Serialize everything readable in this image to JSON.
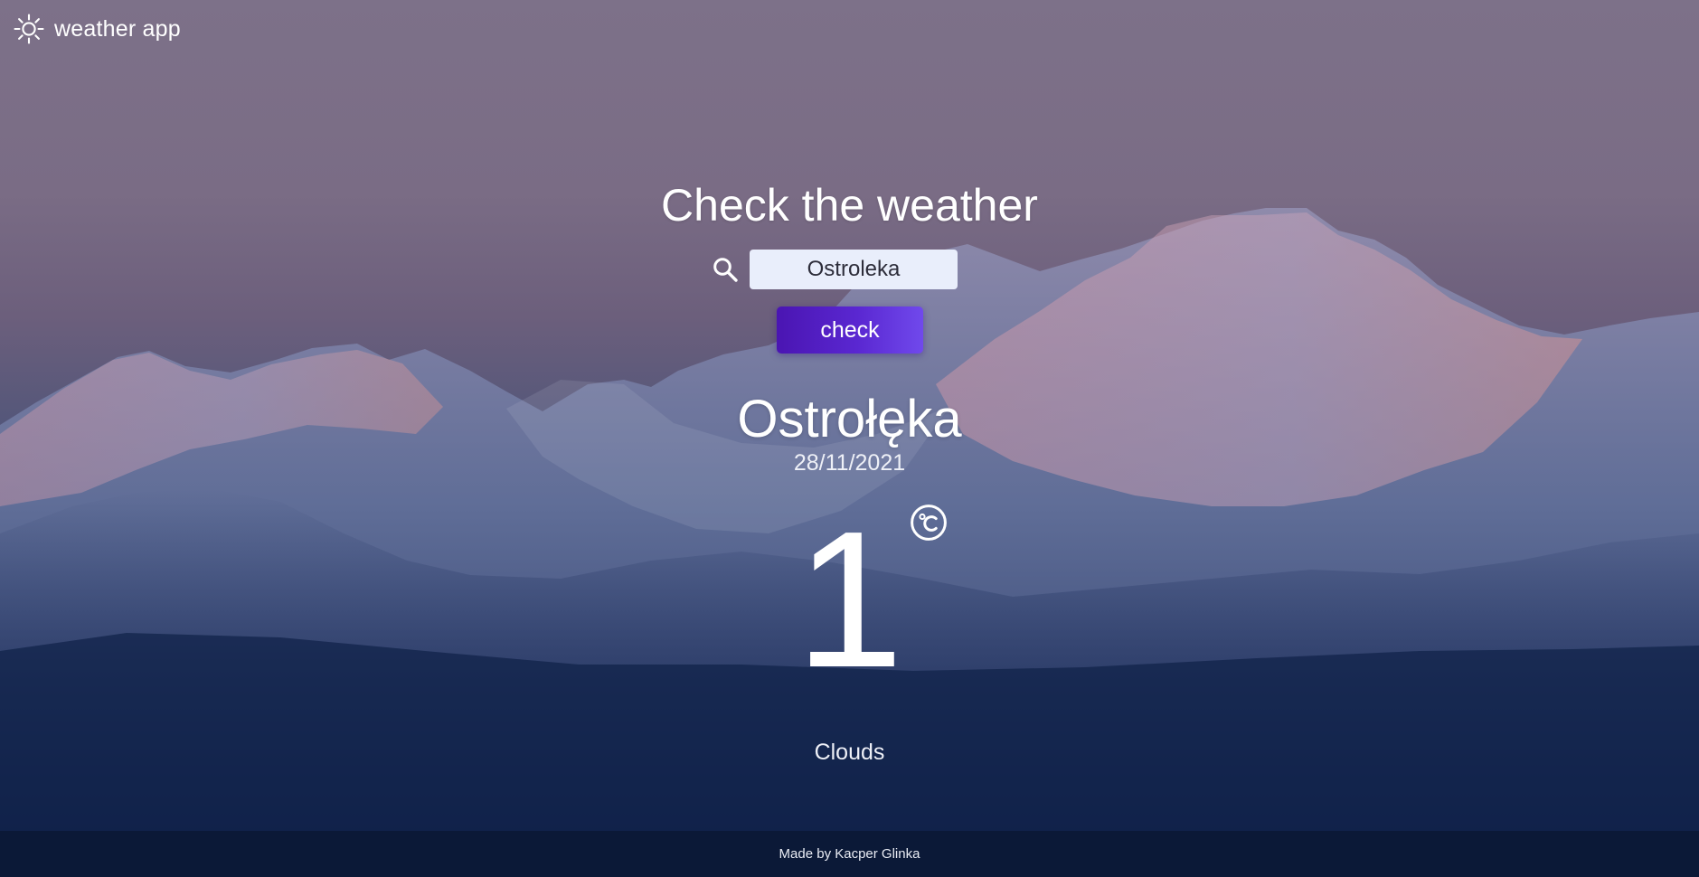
{
  "app": {
    "name": "weather app",
    "logo_icon": "sun-icon"
  },
  "main": {
    "heading": "Check the weather",
    "search_icon": "search-icon",
    "city_input_value": "Ostroleka",
    "check_button_label": "check"
  },
  "result": {
    "city": "Ostrołęka",
    "date": "28/11/2021",
    "temperature": "1",
    "unit_icon": "celsius-icon",
    "condition": "Clouds"
  },
  "footer": {
    "credit": "Made by Kacper Glinka"
  },
  "colors": {
    "button_start": "#4a15b2",
    "button_end": "#7049ec",
    "input_background": "#e9eefb",
    "footer_background": "#0a1834"
  }
}
